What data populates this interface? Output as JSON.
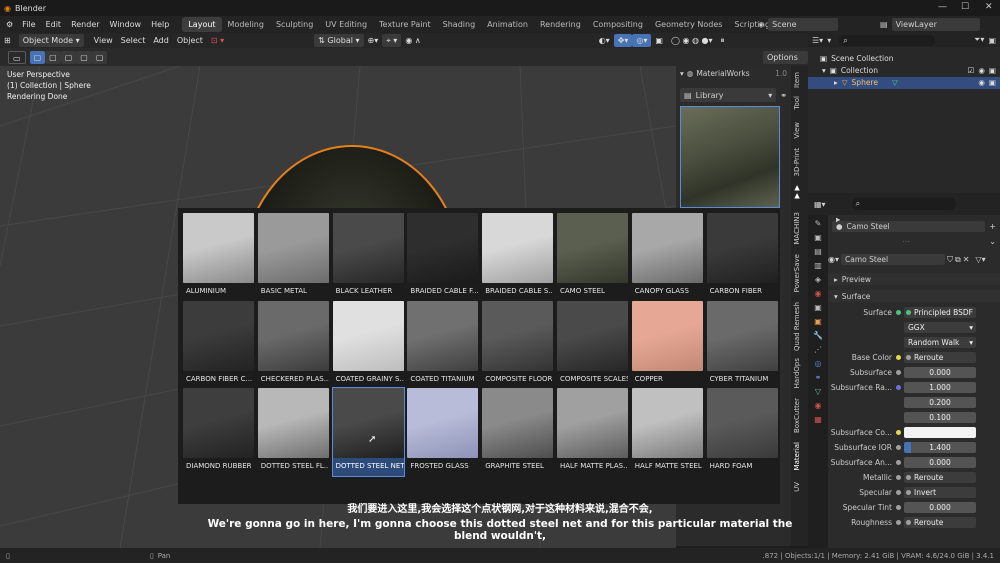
{
  "app": {
    "title": "Blender",
    "window_controls": [
      "—",
      "☐",
      "✕"
    ]
  },
  "menubar": {
    "menus": [
      "File",
      "Edit",
      "Render",
      "Window",
      "Help"
    ],
    "workspaces": [
      "Layout",
      "Modeling",
      "Sculpting",
      "UV Editing",
      "Texture Paint",
      "Shading",
      "Animation",
      "Rendering",
      "Compositing",
      "Geometry Nodes",
      "Scripting"
    ],
    "active_workspace": "Layout",
    "add_tab": "+",
    "scene": "Scene",
    "view_layer": "ViewLayer"
  },
  "viewport_header": {
    "mode": "Object Mode",
    "menus": [
      "View",
      "Select",
      "Add",
      "Object"
    ],
    "transform_orientation": "Global",
    "options": "Options"
  },
  "viewport": {
    "overlay_lines": [
      "User Perspective",
      "(1) Collection | Sphere",
      "Rendering Done"
    ]
  },
  "materialworks": {
    "title": "MaterialWorks",
    "version": "1.0",
    "dropdown": "Library",
    "side_tabs": [
      "Item",
      "Tool",
      "View",
      "3D-Print",
      "MACHIN3",
      "PowerSave",
      "Quad Remesh",
      "HardOps",
      "BoxCutter",
      "Material",
      "UV"
    ]
  },
  "materials": [
    {
      "label": "ALUMINIUM",
      "c1": "#c9c9c9",
      "c2": "#8a8a8a"
    },
    {
      "label": "BASIC METAL",
      "c1": "#9a9a9a",
      "c2": "#6c6c6c"
    },
    {
      "label": "BLACK LEATHER",
      "c1": "#4a4a4a",
      "c2": "#262626"
    },
    {
      "label": "BRAIDED CABLE F...",
      "c1": "#2e2e2e",
      "c2": "#1a1a1a"
    },
    {
      "label": "BRAIDED CABLE S...",
      "c1": "#d8d8d8",
      "c2": "#a0a0a0"
    },
    {
      "label": "CAMO STEEL",
      "c1": "#5b5f4f",
      "c2": "#34382c"
    },
    {
      "label": "CANOPY GLASS",
      "c1": "#a8a8a8",
      "c2": "#6a6a6a"
    },
    {
      "label": "CARBON FIBER",
      "c1": "#3a3a3a",
      "c2": "#202020"
    },
    {
      "label": "CARBON FIBER C...",
      "c1": "#3c3c3c",
      "c2": "#222222"
    },
    {
      "label": "CHECKERED PLAS...",
      "c1": "#6a6a6a",
      "c2": "#3c3c3c"
    },
    {
      "label": "COATED GRAINY S...",
      "c1": "#e0e0e0",
      "c2": "#bdbdbd"
    },
    {
      "label": "COATED TITANIUM",
      "c1": "#707070",
      "c2": "#3f3f3f"
    },
    {
      "label": "COMPOSITE FLOOR",
      "c1": "#5a5a5a",
      "c2": "#333333"
    },
    {
      "label": "COMPOSITE SCALES",
      "c1": "#4a4a4a",
      "c2": "#262626"
    },
    {
      "label": "COPPER",
      "c1": "#e6a894",
      "c2": "#c28874"
    },
    {
      "label": "CYBER TITANIUM",
      "c1": "#6a6a6a",
      "c2": "#404040"
    },
    {
      "label": "DIAMOND RUBBER",
      "c1": "#3e3e3e",
      "c2": "#222222"
    },
    {
      "label": "DOTTED STEEL FL...",
      "c1": "#b8b8b8",
      "c2": "#6e6e6e"
    },
    {
      "label": "DOTTED STEEL NET",
      "c1": "#4a4a4a",
      "c2": "#1e1e1e"
    },
    {
      "label": "FROSTED GLASS",
      "c1": "#b8bcd8",
      "c2": "#8e93b8"
    },
    {
      "label": "GRAPHITE STEEL",
      "c1": "#8a8a8a",
      "c2": "#4e4e4e"
    },
    {
      "label": "HALF MATTE PLAS...",
      "c1": "#a0a0a0",
      "c2": "#5c5c5c"
    },
    {
      "label": "HALF MATTE STEEL",
      "c1": "#c0c0c0",
      "c2": "#7a7a7a"
    },
    {
      "label": "HARD FOAM",
      "c1": "#5a5a5a",
      "c2": "#3a3a3a"
    }
  ],
  "selected_material": "DOTTED STEEL NET",
  "outliner": {
    "root": "Scene Collection",
    "collection": "Collection",
    "object": "Sphere"
  },
  "properties": {
    "slot": "Camo Steel",
    "material_name": "Camo Steel",
    "preview": "Preview",
    "surface": "Surface",
    "rows": [
      {
        "label": "Surface",
        "value": "Principled BSDF",
        "kind": "link",
        "dot": "#4ec27a"
      },
      {
        "label": "",
        "value": "GGX",
        "kind": "select"
      },
      {
        "label": "",
        "value": "Random Walk",
        "kind": "select"
      },
      {
        "label": "Base Color",
        "value": "Reroute",
        "kind": "link",
        "dot": "#e6d84a",
        "arrow": true
      },
      {
        "label": "Subsurface",
        "value": "0.000",
        "kind": "num",
        "dot": "#a0a0a0"
      },
      {
        "label": "Subsurface Ra...",
        "value": "1.000",
        "kind": "num",
        "dot": "#6e6ee0"
      },
      {
        "label": "",
        "value": "0.200",
        "kind": "num"
      },
      {
        "label": "",
        "value": "0.100",
        "kind": "num"
      },
      {
        "label": "Subsurface Co...",
        "value": "",
        "kind": "color",
        "dot": "#e6d84a"
      },
      {
        "label": "Subsurface IOR",
        "value": "1.400",
        "kind": "num",
        "dot": "#a0a0a0"
      },
      {
        "label": "Subsurface An...",
        "value": "0.000",
        "kind": "num",
        "dot": "#a0a0a0"
      },
      {
        "label": "Metallic",
        "value": "Reroute",
        "kind": "link",
        "dot": "#a0a0a0",
        "arrow": true
      },
      {
        "label": "Specular",
        "value": "Invert",
        "kind": "link",
        "dot": "#a0a0a0",
        "arrow": true
      },
      {
        "label": "Specular Tint",
        "value": "0.000",
        "kind": "num",
        "dot": "#a0a0a0"
      },
      {
        "label": "Roughness",
        "value": "Reroute",
        "kind": "link",
        "dot": "#a0a0a0",
        "arrow": true
      }
    ]
  },
  "subtitles": {
    "zh": "我们要进入这里,我会选择这个点状钢网,对于这种材料来说,混合不会,",
    "en": "We're gonna go in here, I'm gonna choose this dotted steel net and for this particular material the blend wouldn't,"
  },
  "statusbar": {
    "left_hint": "Pan",
    "stats": ".872 | Objects:1/1 | Memory: 2.41 GiB | VRAM: 4.6/24.0 GiB | 3.4.1"
  }
}
